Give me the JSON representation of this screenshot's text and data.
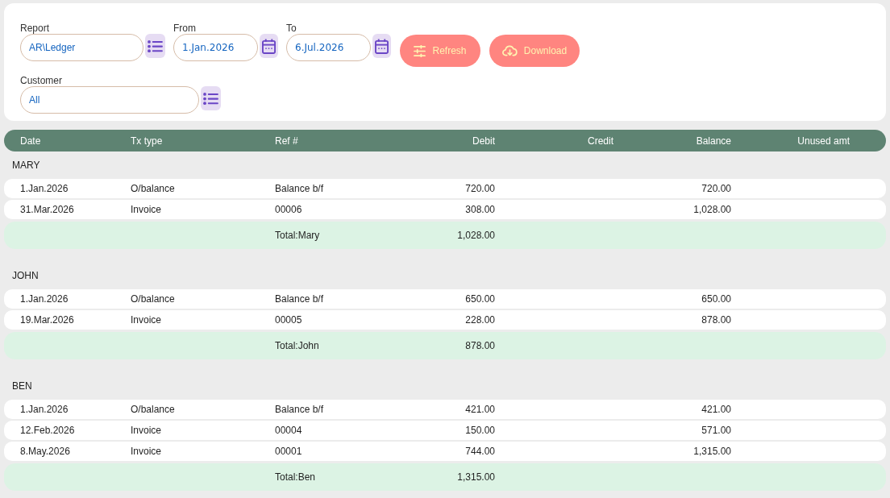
{
  "filters": [
    {
      "label": "Report",
      "value": "AR\\Ledger",
      "kind": "list"
    },
    {
      "label": "From",
      "value": "1.Jan.2026",
      "kind": "date"
    },
    {
      "label": "To",
      "value": "6.Jul.2026",
      "kind": "date"
    }
  ],
  "buttons": [
    {
      "label": "Refresh",
      "kind": "refresh"
    },
    {
      "label": "Download",
      "kind": "download"
    }
  ],
  "customer_filter": {
    "label": "Customer",
    "value": "All",
    "kind": "list"
  },
  "table": {
    "columns": [
      "Date",
      "Tx type",
      "Ref #",
      "Debit",
      "Credit",
      "Balance",
      "Unused amt"
    ],
    "groups": [
      {
        "name": "MARY",
        "rows": [
          {
            "date": "1.Jan.2026",
            "tx_type": "O/balance",
            "ref": "Balance b/f",
            "debit": "720.00",
            "balance": "720.00"
          },
          {
            "date": "31.Mar.2026",
            "tx_type": "Invoice",
            "ref": "00006",
            "debit": "308.00",
            "balance": "1,028.00"
          }
        ],
        "total": {
          "label": "Total:Mary",
          "debit": "1,028.00"
        }
      },
      {
        "name": "JOHN",
        "rows": [
          {
            "date": "1.Jan.2026",
            "tx_type": "O/balance",
            "ref": "Balance b/f",
            "debit": "650.00",
            "balance": "650.00"
          },
          {
            "date": "19.Mar.2026",
            "tx_type": "Invoice",
            "ref": "00005",
            "debit": "228.00",
            "balance": "878.00"
          }
        ],
        "total": {
          "label": "Total:John",
          "debit": "878.00"
        }
      },
      {
        "name": "BEN",
        "rows": [
          {
            "date": "1.Jan.2026",
            "tx_type": "O/balance",
            "ref": "Balance b/f",
            "debit": "421.00",
            "balance": "421.00"
          },
          {
            "date": "12.Feb.2026",
            "tx_type": "Invoice",
            "ref": "00004",
            "debit": "150.00",
            "balance": "571.00"
          },
          {
            "date": "8.May.2026",
            "tx_type": "Invoice",
            "ref": "00001",
            "debit": "744.00",
            "balance": "1,315.00"
          }
        ],
        "total": {
          "label": "Total:Ben",
          "debit": "1,315.00"
        }
      }
    ]
  }
}
